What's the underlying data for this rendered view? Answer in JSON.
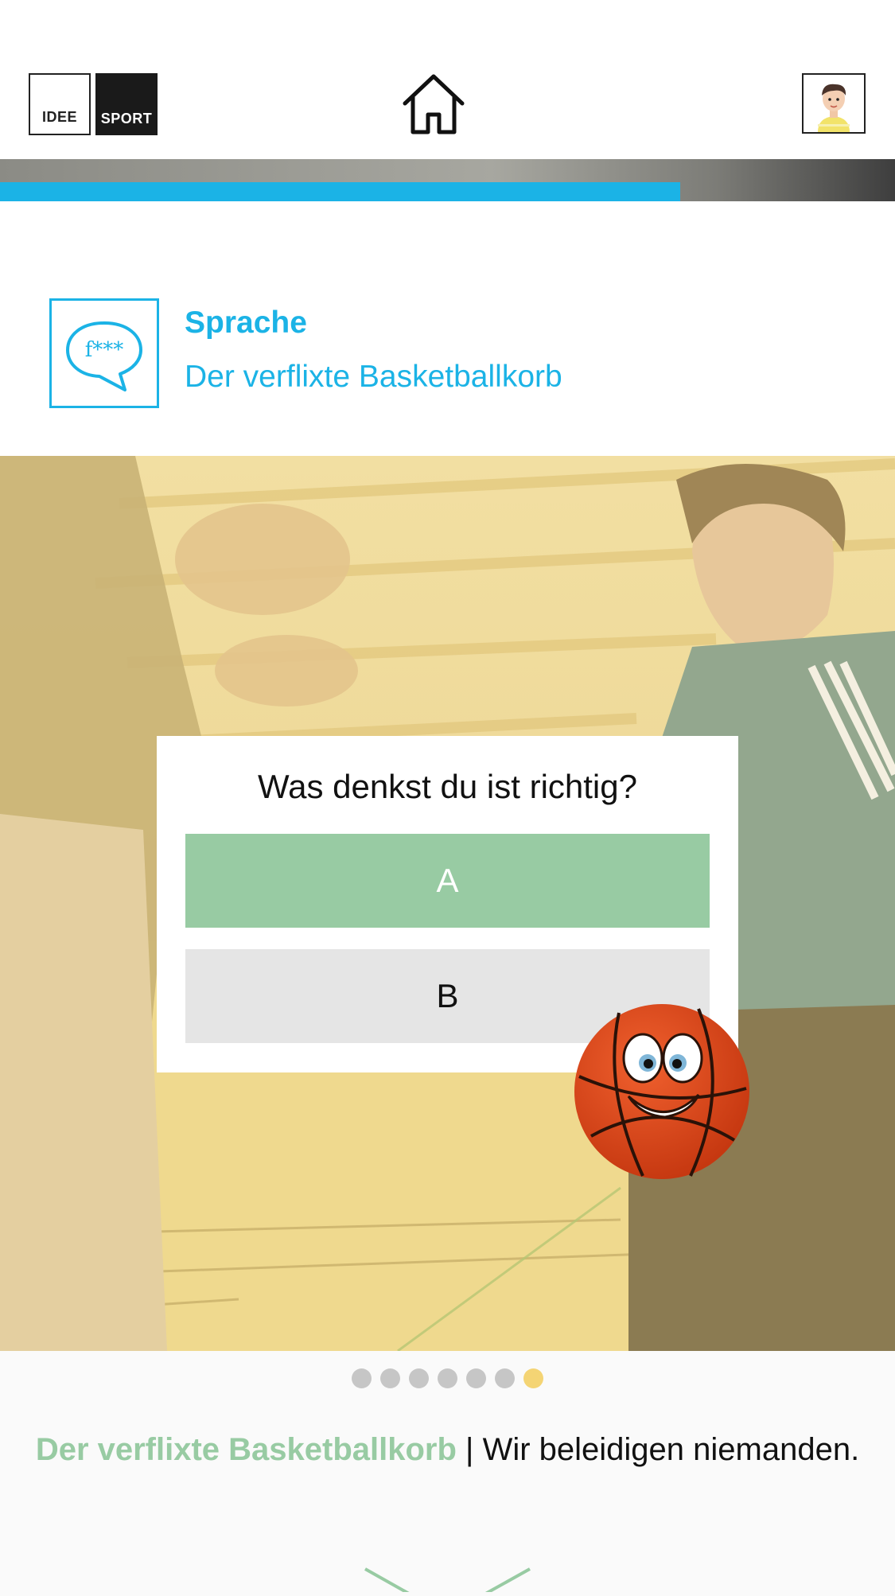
{
  "header": {
    "logo_left": "IDEE",
    "logo_right": "SPORT"
  },
  "progress": {
    "value": 0.76
  },
  "category": {
    "icon_text": "f***",
    "title": "Sprache",
    "subtitle": "Der verflixte Basketballkorb"
  },
  "quiz": {
    "question": "Was denkst du ist richtig?",
    "answers": [
      {
        "label": "A",
        "selected": true
      },
      {
        "label": "B",
        "selected": false
      }
    ]
  },
  "pagination": {
    "count": 7,
    "active_index": 6
  },
  "caption": {
    "highlight": "Der verflixte Basketballkorb",
    "separator": " | ",
    "text": "Wir beleidigen niemanden."
  },
  "colors": {
    "accent_blue": "#1bb3e6",
    "answer_green": "#98cba3",
    "answer_grey": "#e5e5e5",
    "dot_active": "#f4d474",
    "dot_inactive": "#c6c6c6"
  },
  "icons": [
    "home-icon",
    "avatar-icon",
    "speech-bubble-icon",
    "basketball-mascot",
    "chevron-down-icon"
  ]
}
